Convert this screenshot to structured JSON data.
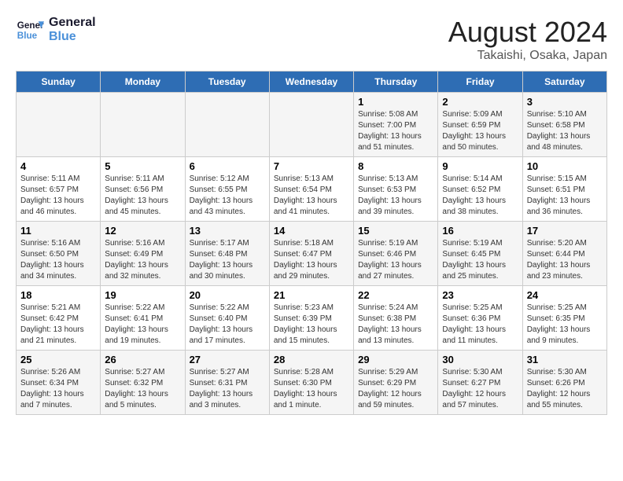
{
  "logo": {
    "line1": "General",
    "line2": "Blue"
  },
  "title": "August 2024",
  "subtitle": "Takaishi, Osaka, Japan",
  "weekdays": [
    "Sunday",
    "Monday",
    "Tuesday",
    "Wednesday",
    "Thursday",
    "Friday",
    "Saturday"
  ],
  "weeks": [
    [
      {
        "day": "",
        "info": ""
      },
      {
        "day": "",
        "info": ""
      },
      {
        "day": "",
        "info": ""
      },
      {
        "day": "",
        "info": ""
      },
      {
        "day": "1",
        "info": "Sunrise: 5:08 AM\nSunset: 7:00 PM\nDaylight: 13 hours\nand 51 minutes."
      },
      {
        "day": "2",
        "info": "Sunrise: 5:09 AM\nSunset: 6:59 PM\nDaylight: 13 hours\nand 50 minutes."
      },
      {
        "day": "3",
        "info": "Sunrise: 5:10 AM\nSunset: 6:58 PM\nDaylight: 13 hours\nand 48 minutes."
      }
    ],
    [
      {
        "day": "4",
        "info": "Sunrise: 5:11 AM\nSunset: 6:57 PM\nDaylight: 13 hours\nand 46 minutes."
      },
      {
        "day": "5",
        "info": "Sunrise: 5:11 AM\nSunset: 6:56 PM\nDaylight: 13 hours\nand 45 minutes."
      },
      {
        "day": "6",
        "info": "Sunrise: 5:12 AM\nSunset: 6:55 PM\nDaylight: 13 hours\nand 43 minutes."
      },
      {
        "day": "7",
        "info": "Sunrise: 5:13 AM\nSunset: 6:54 PM\nDaylight: 13 hours\nand 41 minutes."
      },
      {
        "day": "8",
        "info": "Sunrise: 5:13 AM\nSunset: 6:53 PM\nDaylight: 13 hours\nand 39 minutes."
      },
      {
        "day": "9",
        "info": "Sunrise: 5:14 AM\nSunset: 6:52 PM\nDaylight: 13 hours\nand 38 minutes."
      },
      {
        "day": "10",
        "info": "Sunrise: 5:15 AM\nSunset: 6:51 PM\nDaylight: 13 hours\nand 36 minutes."
      }
    ],
    [
      {
        "day": "11",
        "info": "Sunrise: 5:16 AM\nSunset: 6:50 PM\nDaylight: 13 hours\nand 34 minutes."
      },
      {
        "day": "12",
        "info": "Sunrise: 5:16 AM\nSunset: 6:49 PM\nDaylight: 13 hours\nand 32 minutes."
      },
      {
        "day": "13",
        "info": "Sunrise: 5:17 AM\nSunset: 6:48 PM\nDaylight: 13 hours\nand 30 minutes."
      },
      {
        "day": "14",
        "info": "Sunrise: 5:18 AM\nSunset: 6:47 PM\nDaylight: 13 hours\nand 29 minutes."
      },
      {
        "day": "15",
        "info": "Sunrise: 5:19 AM\nSunset: 6:46 PM\nDaylight: 13 hours\nand 27 minutes."
      },
      {
        "day": "16",
        "info": "Sunrise: 5:19 AM\nSunset: 6:45 PM\nDaylight: 13 hours\nand 25 minutes."
      },
      {
        "day": "17",
        "info": "Sunrise: 5:20 AM\nSunset: 6:44 PM\nDaylight: 13 hours\nand 23 minutes."
      }
    ],
    [
      {
        "day": "18",
        "info": "Sunrise: 5:21 AM\nSunset: 6:42 PM\nDaylight: 13 hours\nand 21 minutes."
      },
      {
        "day": "19",
        "info": "Sunrise: 5:22 AM\nSunset: 6:41 PM\nDaylight: 13 hours\nand 19 minutes."
      },
      {
        "day": "20",
        "info": "Sunrise: 5:22 AM\nSunset: 6:40 PM\nDaylight: 13 hours\nand 17 minutes."
      },
      {
        "day": "21",
        "info": "Sunrise: 5:23 AM\nSunset: 6:39 PM\nDaylight: 13 hours\nand 15 minutes."
      },
      {
        "day": "22",
        "info": "Sunrise: 5:24 AM\nSunset: 6:38 PM\nDaylight: 13 hours\nand 13 minutes."
      },
      {
        "day": "23",
        "info": "Sunrise: 5:25 AM\nSunset: 6:36 PM\nDaylight: 13 hours\nand 11 minutes."
      },
      {
        "day": "24",
        "info": "Sunrise: 5:25 AM\nSunset: 6:35 PM\nDaylight: 13 hours\nand 9 minutes."
      }
    ],
    [
      {
        "day": "25",
        "info": "Sunrise: 5:26 AM\nSunset: 6:34 PM\nDaylight: 13 hours\nand 7 minutes."
      },
      {
        "day": "26",
        "info": "Sunrise: 5:27 AM\nSunset: 6:32 PM\nDaylight: 13 hours\nand 5 minutes."
      },
      {
        "day": "27",
        "info": "Sunrise: 5:27 AM\nSunset: 6:31 PM\nDaylight: 13 hours\nand 3 minutes."
      },
      {
        "day": "28",
        "info": "Sunrise: 5:28 AM\nSunset: 6:30 PM\nDaylight: 13 hours\nand 1 minute."
      },
      {
        "day": "29",
        "info": "Sunrise: 5:29 AM\nSunset: 6:29 PM\nDaylight: 12 hours\nand 59 minutes."
      },
      {
        "day": "30",
        "info": "Sunrise: 5:30 AM\nSunset: 6:27 PM\nDaylight: 12 hours\nand 57 minutes."
      },
      {
        "day": "31",
        "info": "Sunrise: 5:30 AM\nSunset: 6:26 PM\nDaylight: 12 hours\nand 55 minutes."
      }
    ]
  ]
}
